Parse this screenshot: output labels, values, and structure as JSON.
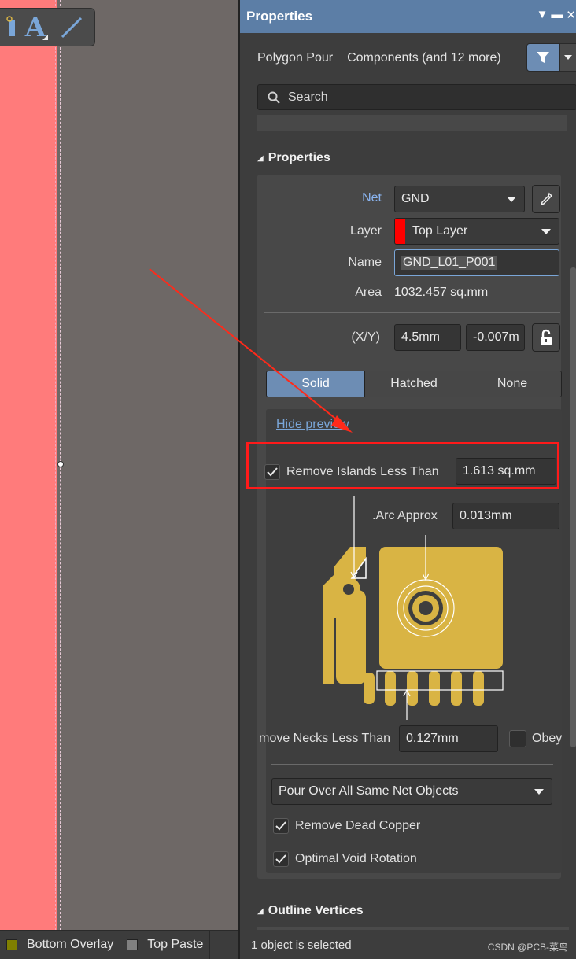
{
  "canvas": {
    "tools": [
      "text-tool",
      "line-tool"
    ],
    "tool_glyph_text": "A"
  },
  "layer_tabs": [
    {
      "label": "Bottom Overlay",
      "color": "#808000"
    },
    {
      "label": "Top Paste",
      "color": "#808080"
    }
  ],
  "panel": {
    "title": "Properties",
    "window_controls": [
      "▼",
      "▬",
      "✕"
    ],
    "selection_kind": "Polygon Pour",
    "selection_filter": "Components (and 12 more)",
    "search_placeholder": "Search",
    "section_properties": "Properties",
    "net": {
      "label": "Net",
      "value": "GND"
    },
    "layer": {
      "label": "Layer",
      "value": "Top Layer",
      "swatch": "#ff0000"
    },
    "name": {
      "label": "Name",
      "value": "GND_L01_P001"
    },
    "area": {
      "label": "Area",
      "value": "1032.457 sq.mm"
    },
    "xy": {
      "label": "(X/Y)",
      "x": "4.5mm",
      "y": "-0.007m"
    },
    "fill_modes": [
      {
        "label": "Solid",
        "active": true
      },
      {
        "label": "Hatched",
        "active": false
      },
      {
        "label": "None",
        "active": false
      }
    ],
    "hide_preview": "Hide preview",
    "remove_islands": {
      "label": "Remove Islands Less Than",
      "value": "1.613 sq.mm",
      "checked": true
    },
    "arc_approx": {
      "label": "Arc Approx.",
      "value": "0.013mm"
    },
    "remove_necks": {
      "label": "Remove Necks Less Than",
      "value": "0.127mm"
    },
    "obey_label": "Obey",
    "pour_over": "Pour Over All Same Net Objects",
    "remove_dead_copper": {
      "label": "Remove Dead Copper",
      "checked": true
    },
    "optimal_void_rotation": {
      "label": "Optimal Void Rotation",
      "checked": true
    },
    "section_outline": "Outline Vertices",
    "status": "1 object is selected",
    "watermark": "CSDN @PCB-菜鸟"
  },
  "colors": {
    "accent": "#6d8db4",
    "copper": "#d9b444",
    "highlight_red": "#ff1a1a",
    "canvas_pink": "#ff7b7b"
  }
}
